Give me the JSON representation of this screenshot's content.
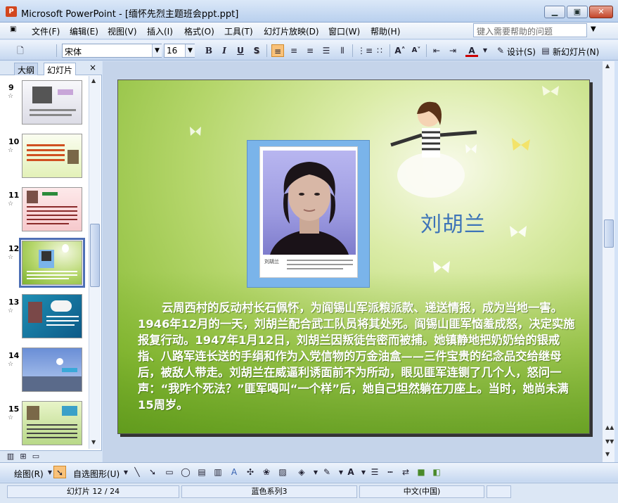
{
  "window": {
    "title": "Microsoft PowerPoint - [缅怀先烈主题班会ppt.ppt]",
    "app_icon_letter": "P"
  },
  "menu": [
    "文件(F)",
    "编辑(E)",
    "视图(V)",
    "插入(I)",
    "格式(O)",
    "工具(T)",
    "幻灯片放映(D)",
    "窗口(W)",
    "帮助(H)"
  ],
  "help_placeholder": "键入需要帮助的问题",
  "toolbar": {
    "font_name": "宋体",
    "font_size": "16",
    "bold": "B",
    "italic": "I",
    "underline": "U",
    "shadow": "S",
    "design_label": "设计(S)",
    "new_slide_label": "新幻灯片(N)"
  },
  "left_pane": {
    "tab_outline": "大纲",
    "tab_slides": "幻灯片",
    "close": "×",
    "slides": [
      {
        "num": "9",
        "star": "☆"
      },
      {
        "num": "10",
        "star": "☆"
      },
      {
        "num": "11",
        "star": "☆"
      },
      {
        "num": "12",
        "star": "☆"
      },
      {
        "num": "13",
        "star": "☆"
      },
      {
        "num": "14",
        "star": "☆"
      },
      {
        "num": "15",
        "star": "☆"
      }
    ]
  },
  "slide": {
    "title": "刘胡兰",
    "caption_name": "刘胡兰",
    "body": "云周西村的反动村长石佩怀，为阎锡山军派粮派款、递送情报，成为当地一害。1946年12月的一天，刘胡兰配合武工队员将其处死。阎锡山匪军恼羞成怒，决定实施报复行动。1947年1月12日，刘胡兰因叛徒告密而被捕。她镇静地把奶奶给的银戒指、八路军连长送的手绢和作为入党信物的万金油盒——三件宝贵的纪念品交给继母后，被敌人带走。刘胡兰在威逼利诱面前不为所动，眼见匪军连铡了几个人，怒问一声：“我咋个死法？”匪军喝叫“一个样”后，她自己坦然躺在刀座上。当时，她尚未满15周岁。"
  },
  "drawbar": {
    "draw_label": "绘图(R)",
    "autoshape_label": "自选图形(U)"
  },
  "status": {
    "slide_info": "幻灯片 12 / 24",
    "theme": "蓝色系列3",
    "language": "中文(中国)"
  }
}
